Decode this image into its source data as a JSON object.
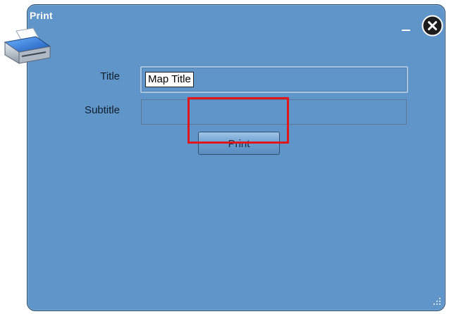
{
  "window": {
    "title": "Print"
  },
  "icons": {
    "printer": "printer-icon",
    "minimize": "minimize-icon",
    "close": "close-icon",
    "resize": "resize-grip-icon"
  },
  "form": {
    "title_label": "Title",
    "title_value": "Map Title",
    "subtitle_label": "Subtitle",
    "subtitle_value": ""
  },
  "buttons": {
    "print_label": "Print"
  },
  "colors": {
    "window_bg": "#5f95c8",
    "highlight": "#e0161b"
  }
}
